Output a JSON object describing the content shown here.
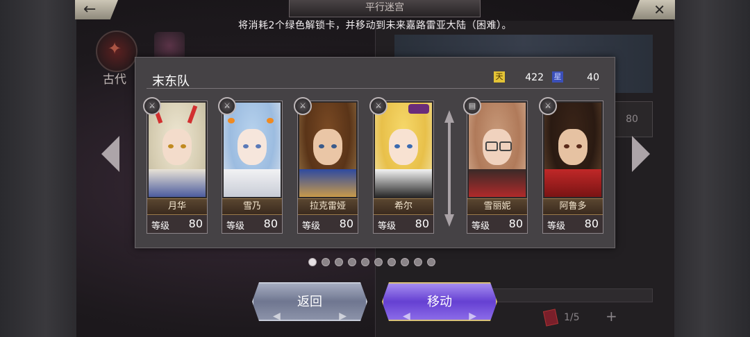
{
  "header": {
    "title": "平行迷宫",
    "back_icon": "←",
    "close_icon": "✕",
    "notice": "将消耗2个绿色解锁卡，并移动到未来嘉路雷亚大陆（困难）。"
  },
  "background": {
    "era_label": "古代",
    "level_value": "80",
    "page_indicator": "1/5",
    "plus_icon": "+"
  },
  "team": {
    "name": "末东队",
    "resources": [
      {
        "icon": "天",
        "value": "422",
        "color": "#e3c336"
      },
      {
        "icon": "星",
        "value": "40",
        "color": "#3b4fb8"
      }
    ],
    "level_label": "等级",
    "members": [
      {
        "name": "月华",
        "level": "80",
        "weapon_icon": "sword-icon"
      },
      {
        "name": "雪乃",
        "level": "80",
        "weapon_icon": "dual-sword-icon"
      },
      {
        "name": "拉克雷娅",
        "level": "80",
        "weapon_icon": "dual-sword-icon"
      },
      {
        "name": "希尔",
        "level": "80",
        "weapon_icon": "dual-sword-icon"
      },
      {
        "name": "雪丽妮",
        "level": "80",
        "weapon_icon": "book-icon"
      },
      {
        "name": "阿鲁多",
        "level": "80",
        "weapon_icon": "sword-icon"
      }
    ]
  },
  "pagination": {
    "count": 10,
    "active_index": 0
  },
  "buttons": {
    "back_label": "返回",
    "move_label": "移动"
  }
}
